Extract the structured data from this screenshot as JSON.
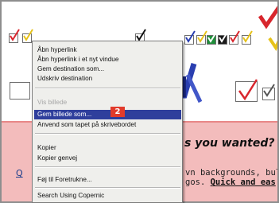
{
  "webpage": {
    "heading": "s you wanted?",
    "body_line1": "vn backgrounds, bull",
    "body_line2_prefix": "gos. ",
    "body_link": "Quick and eas",
    "q_letter": "Q"
  },
  "context_menu": {
    "items": [
      {
        "label": "Åbn hyperlink",
        "state": "normal"
      },
      {
        "label": "Åbn hyperlink i et nyt vindue",
        "state": "normal"
      },
      {
        "label": "Gem destination som...",
        "state": "normal"
      },
      {
        "label": "Udskriv destination",
        "state": "normal"
      },
      {
        "label": "Vis billede",
        "state": "disabled"
      },
      {
        "label": "Gem billede som...",
        "state": "selected"
      },
      {
        "label": "Anvend som tapet på skrivebordet",
        "state": "normal"
      },
      {
        "label": "Kopier",
        "state": "normal"
      },
      {
        "label": "Kopier genvej",
        "state": "normal"
      },
      {
        "label": "Føj til Foretrukne...",
        "state": "normal"
      },
      {
        "label": "Search Using Copernic",
        "state": "normal"
      }
    ]
  },
  "step_badge": "2",
  "colors": {
    "menu_bg": "#efefec",
    "selected_bg": "#2f3f9c",
    "disabled_text": "#a6a6a6",
    "pink_bg": "#f3bcbc",
    "badge_red": "#e23b2b",
    "check_red": "#d8262d",
    "check_yellow": "#e6c21a",
    "check_blue": "#2a3fb0",
    "check_green": "#1f8f3a"
  }
}
